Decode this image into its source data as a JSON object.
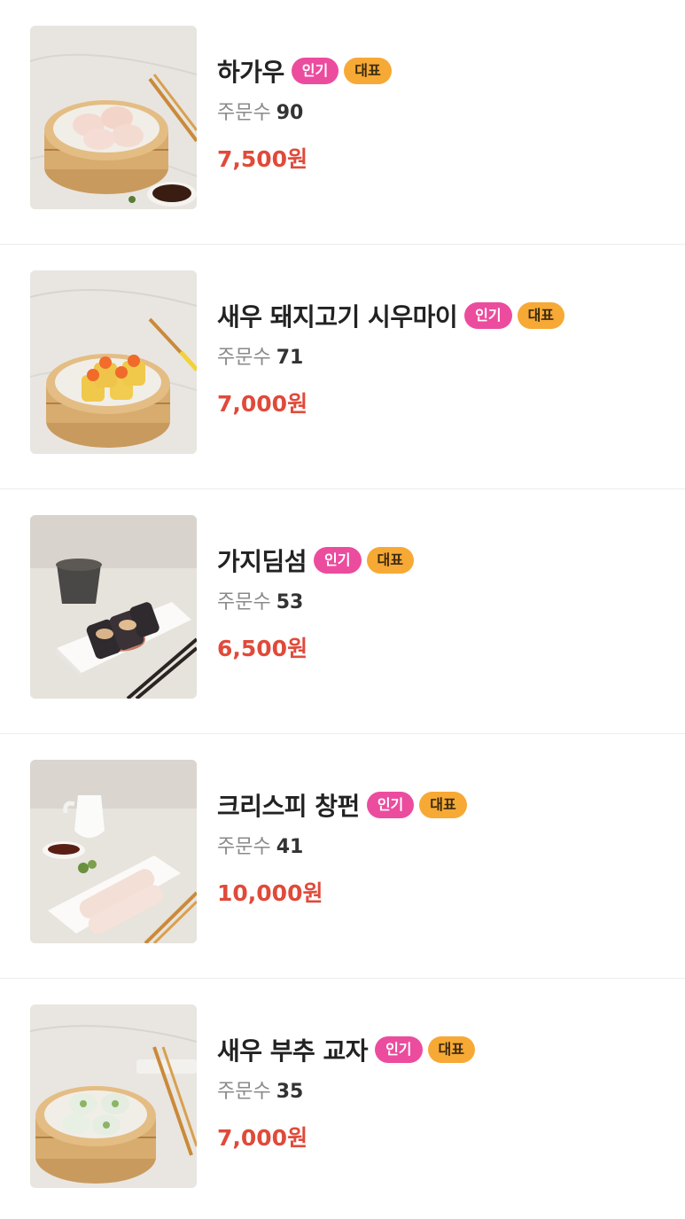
{
  "menu": {
    "items": [
      {
        "name": "하가우",
        "badge_popular": "인기",
        "badge_signature": "대표",
        "orders_label": "주문수",
        "orders_count": "90",
        "price": "7,500원",
        "image": "steamer-basket-har-gow"
      },
      {
        "name": "새우 돼지고기 시우마이",
        "badge_popular": "인기",
        "badge_signature": "대표",
        "orders_label": "주문수",
        "orders_count": "71",
        "price": "7,000원",
        "image": "steamer-basket-siu-mai"
      },
      {
        "name": "가지딤섬",
        "badge_popular": "인기",
        "badge_signature": "대표",
        "orders_label": "주문수",
        "orders_count": "53",
        "price": "6,500원",
        "image": "plate-eggplant-dimsum"
      },
      {
        "name": "크리스피 창펀",
        "badge_popular": "인기",
        "badge_signature": "대표",
        "orders_label": "주문수",
        "orders_count": "41",
        "price": "10,000원",
        "image": "plate-rice-noodle-roll"
      },
      {
        "name": "새우 부추 교자",
        "badge_popular": "인기",
        "badge_signature": "대표",
        "orders_label": "주문수",
        "orders_count": "35",
        "price": "7,000원",
        "image": "steamer-basket-chive-dumpling"
      }
    ]
  },
  "colors": {
    "price": "#e04a3a",
    "badge_popular": "#ec4c9e",
    "badge_signature": "#f7a935"
  }
}
